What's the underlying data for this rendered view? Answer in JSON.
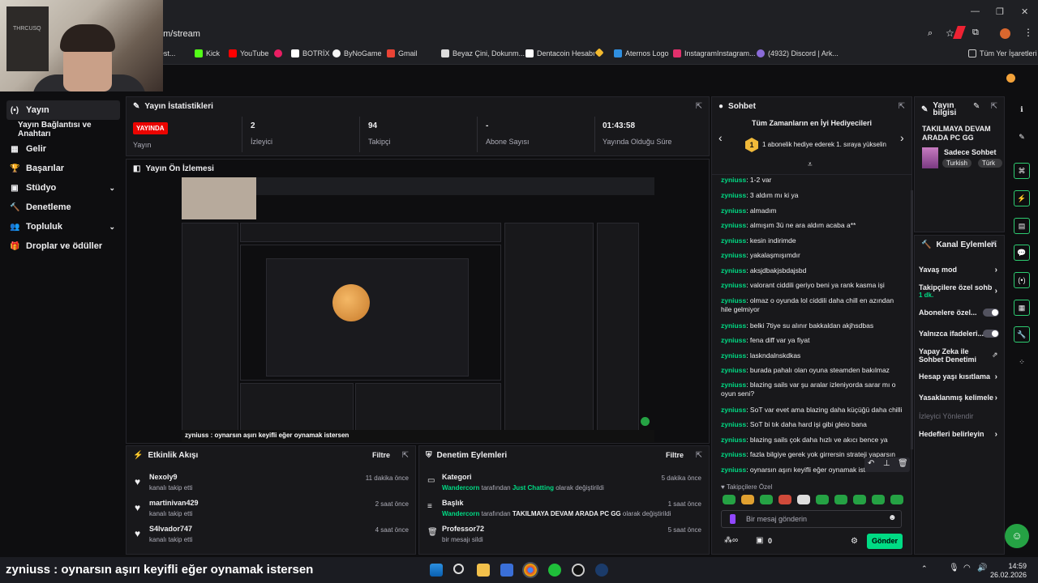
{
  "browser": {
    "url": "om/stream",
    "bookmarks": [
      "d Test...",
      "Kick",
      "YouTube",
      "BOTRİX",
      "ByNoGame",
      "Gmail",
      "Beyaz Çini, Dokunm...",
      "Dentacoin Hesabı",
      "Aternos Logo",
      "InstagramInstagram...",
      "(4932) Discord | Ark...",
      "Tüm Yer İşaretleri"
    ]
  },
  "webcam": {
    "poster_text": "THRCUSQ"
  },
  "nav": {
    "items": [
      {
        "label": "Yayın",
        "icon": "(•)"
      },
      {
        "label": "Yayın Bağlantısı ve Anahtarı",
        "icon": ""
      },
      {
        "label": "Gelir",
        "icon": "▦"
      },
      {
        "label": "Başarılar",
        "icon": "🏆"
      },
      {
        "label": "Stüdyo",
        "icon": "▣"
      },
      {
        "label": "Denetleme",
        "icon": "🔨"
      },
      {
        "label": "Topluluk",
        "icon": "👥"
      },
      {
        "label": "Droplar ve ödüller",
        "icon": "🎁"
      }
    ]
  },
  "stats": {
    "title": "Yayın İstatistikleri",
    "live_badge": "YAYINDA",
    "items": [
      {
        "value": "",
        "label": "Yayın"
      },
      {
        "value": "2",
        "label": "İzleyici"
      },
      {
        "value": "94",
        "label": "Takipçi"
      },
      {
        "value": "-",
        "label": "Abone Sayısı"
      },
      {
        "value": "01:43:58",
        "label": "Yayında Olduğu Süre"
      }
    ]
  },
  "preview": {
    "title": "Yayın Ön İzlemesi",
    "caption": "zyniuss : oynarsın aşırı keyifli eğer oynamak istersen"
  },
  "activity": {
    "title": "Etkinlik Akışı",
    "filter": "Filtre",
    "items": [
      {
        "name": "Nexoly9",
        "sub": "kanalı takip etti",
        "time": "11 dakika önce"
      },
      {
        "name": "martinivan429",
        "sub": "kanalı takip etti",
        "time": "2 saat önce"
      },
      {
        "name": "S4lvador747",
        "sub": "kanalı takip etti",
        "time": "4 saat önce"
      }
    ]
  },
  "mod": {
    "title": "Denetim Eylemleri",
    "filter": "Filtre",
    "items": [
      {
        "title": "Kategori",
        "who": "Wandercorn",
        "mid": " tarafından ",
        "val": "Just Chatting",
        "end": " olarak değiştirildi",
        "time": "5 dakika önce",
        "icon": "▭"
      },
      {
        "title": "Başlık",
        "who": "Wandercorn",
        "mid": " tarafından ",
        "val": "TAKILMAYA DEVAM ARADA PC GG",
        "end": " olarak değiştirildi",
        "time": "1 saat önce",
        "icon": "≡"
      },
      {
        "title": "Professor72",
        "who": "",
        "mid": "",
        "val": "",
        "end": "bir mesajı sildi",
        "time": "5 saat önce",
        "icon": "🗑"
      }
    ]
  },
  "chat": {
    "title": "Sohbet",
    "top_gifters_title": "Tüm Zamanların en İyi Hediyecileri",
    "top_gifters_sub": "1 abonelik hediye ederek 1. sıraya yükselin",
    "rank": "1",
    "messages": [
      {
        "user": "zyniuss",
        "text": "1-2 var"
      },
      {
        "user": "zyniuss",
        "text": "3 aldım mı ki ya"
      },
      {
        "user": "zyniuss",
        "text": "almadım"
      },
      {
        "user": "zyniuss",
        "text": "almışım 3ü ne ara aldım acaba a**"
      },
      {
        "user": "zyniuss",
        "text": "kesin indirimde"
      },
      {
        "user": "zyniuss",
        "text": "yakalaşmışımdır"
      },
      {
        "user": "zyniuss",
        "text": "aksjdbakjsbdajsbd"
      },
      {
        "user": "zyniuss",
        "text": "valorant ciddili geriyo beni ya rank kasma işi"
      },
      {
        "user": "zyniuss",
        "text": "olmaz o oyunda lol ciddili daha chill en azından hile gelmiyor"
      },
      {
        "user": "zyniuss",
        "text": "belki 7tiye su alınır bakkaldan akjhsdbas"
      },
      {
        "user": "zyniuss",
        "text": "fena diff var ya fiyat"
      },
      {
        "user": "zyniuss",
        "text": "laskndalnskdkas"
      },
      {
        "user": "zyniuss",
        "text": "burada pahalı olan oyuna steamden bakılmaz"
      },
      {
        "user": "zyniuss",
        "text": "blazing sails var şu aralar izleniyorda sarar mı o oyun seni?"
      },
      {
        "user": "zyniuss",
        "text": "SoT var evet ama blazing daha küçüğü daha chilli"
      },
      {
        "user": "zyniuss",
        "text": "SoT bi tık daha hard işi gibi gleio bana"
      },
      {
        "user": "zyniuss",
        "text": "blazing sails çok daha hızlı ve akıcı bence ya"
      },
      {
        "user": "zyniuss",
        "text": "fazla bilgiye gerek yok girrersin strateji yaparsın"
      },
      {
        "user": "zyniuss",
        "text": "oynarsın aşırı keyifli eğer oynamak istersen"
      }
    ],
    "followers_only": "Takipçilere Özel",
    "placeholder": "Bir mesaj gönderin",
    "points": "0",
    "send": "Gönder"
  },
  "stream_info": {
    "title": "Yayın bilgisi",
    "stream_title": "TAKILMAYA DEVAM ARADA PC GG",
    "category": "Sadece Sohbet",
    "tags": [
      "Turkish",
      "Türk"
    ]
  },
  "channel_actions": {
    "title": "Kanal Eylemleri",
    "items": [
      {
        "label": "Yavaş mod",
        "sub": "",
        "type": "chevron"
      },
      {
        "label": "Takipçilere özel sohb",
        "sub": "1 dk.",
        "type": "chevron"
      },
      {
        "label": "Abonelere özel...",
        "sub": "",
        "type": "toggle"
      },
      {
        "label": "Yalnızca ifadeleri...",
        "sub": "",
        "type": "toggle"
      },
      {
        "label": "Yapay Zeka ile Sohbet Denetimi",
        "sub": "",
        "type": "external"
      },
      {
        "label": "Hesap yaşı kısıtlama",
        "sub": "",
        "type": "chevron"
      },
      {
        "label": "Yasaklanmış kelimele",
        "sub": "",
        "type": "chevron"
      },
      {
        "label": "İzleyici Yönlendir",
        "sub": "",
        "type": "disabled"
      },
      {
        "label": "Hedefleri belirleyin",
        "sub": "",
        "type": "chevron"
      }
    ]
  },
  "taskbar": {
    "time": "14:59",
    "date": "26.02.2026"
  },
  "colors": {
    "accent": "#00db84",
    "live": "#eb0400",
    "send": "#00db84",
    "panel": "#18181b"
  }
}
